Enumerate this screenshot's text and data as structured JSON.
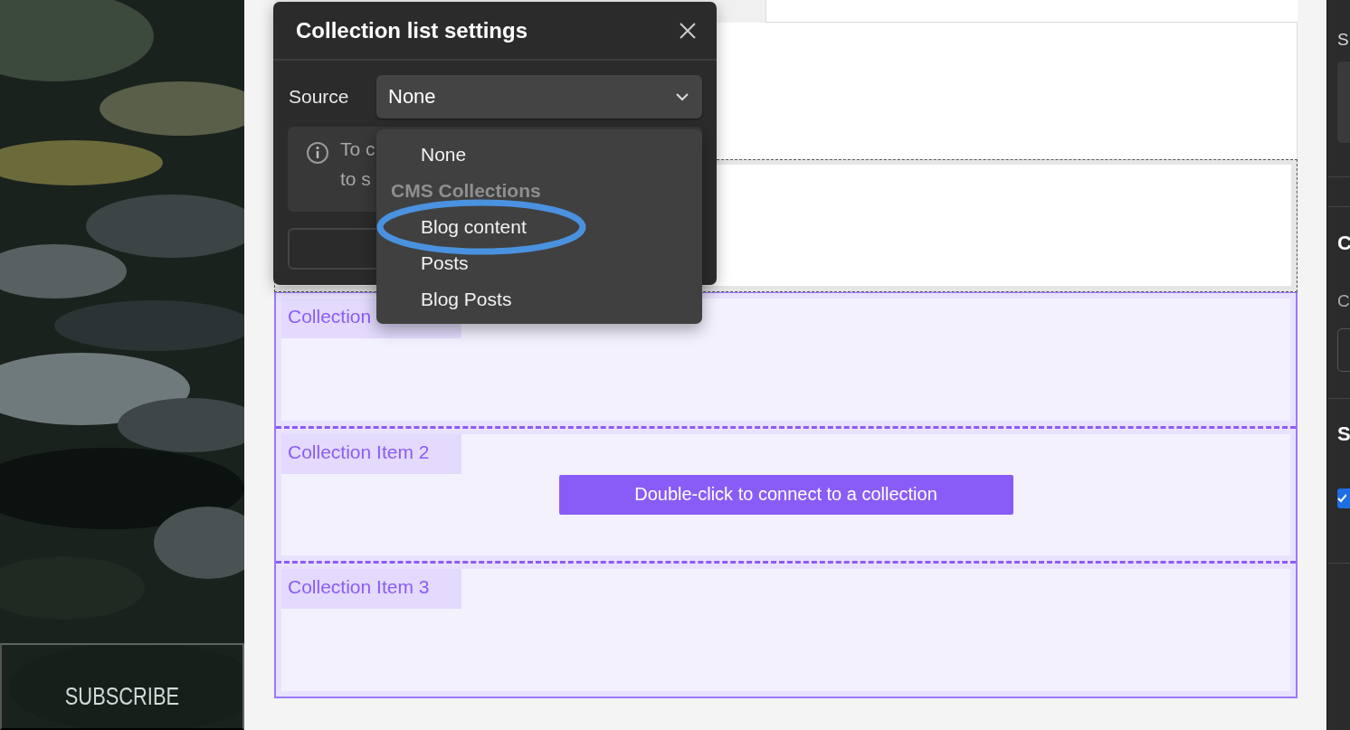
{
  "left_column": {
    "button": "SUBSCRIBE"
  },
  "canvas": {
    "items": [
      {
        "label": "Collection"
      },
      {
        "label": "Collection Item 2",
        "button": "Double-click to connect to a collection"
      },
      {
        "label": "Collection Item 3"
      }
    ]
  },
  "modal": {
    "title": "Collection list settings",
    "source_label": "Source",
    "source_value": "None",
    "info_lines": [
      "To c",
      "to s"
    ]
  },
  "dropdown": {
    "items": [
      {
        "kind": "option",
        "label": "None",
        "circled": false
      },
      {
        "kind": "header",
        "label": "CMS Collections",
        "circled": false
      },
      {
        "kind": "option",
        "label": "Blog content",
        "circled": true
      },
      {
        "kind": "option",
        "label": "Posts",
        "circled": false
      },
      {
        "kind": "option",
        "label": "Blog Posts",
        "circled": false
      }
    ]
  },
  "right_panel": {
    "sections": [
      {
        "rows": [
          {
            "kind": "label",
            "text": "S"
          },
          {
            "kind": "field",
            "outlined": false
          }
        ]
      },
      {
        "rows": [
          {
            "kind": "heading",
            "text": "C"
          },
          {
            "kind": "label",
            "text": "C"
          },
          {
            "kind": "field",
            "outlined": true
          }
        ]
      },
      {
        "rows": [
          {
            "kind": "heading",
            "text": "S"
          },
          {
            "kind": "checkbox",
            "checked": true
          }
        ]
      }
    ]
  }
}
